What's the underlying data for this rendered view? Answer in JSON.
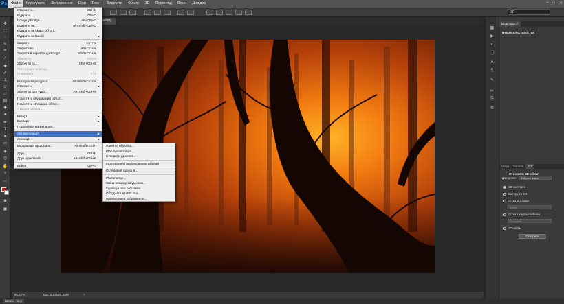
{
  "app": {
    "logo": "Ps"
  },
  "menubar": [
    "Файл",
    "Редагувати",
    "Зображення",
    "Шар",
    "Текст",
    "Виділити",
    "Фільтр",
    "3D",
    "Перегляд",
    "Вікно",
    "Довідка"
  ],
  "options": {
    "workspace": "3D"
  },
  "tabs": [
    {
      "label": "…ерфейс.png @ 50% (RGB/8#)",
      "active": false
    },
    {
      "label": "66.jpg @ 66,7% (RGB/8#)",
      "active": true
    }
  ],
  "file_menu": [
    {
      "label": "Створити ...",
      "shortcut": "Ctrl+N",
      "state": "normal"
    },
    {
      "label": "Відкрити...",
      "shortcut": "Ctrl+O",
      "state": "normal"
    },
    {
      "label": "Пошук у Bridge...",
      "shortcut": "Alt+Ctrl+O",
      "state": "normal"
    },
    {
      "label": "Відкрити як...",
      "shortcut": "Alt+Shift+Ctrl+O",
      "state": "normal"
    },
    {
      "label": "Відкрити як смарт-об'єкт...",
      "shortcut": "",
      "state": "normal"
    },
    {
      "label": "Відкрити останній",
      "shortcut": "",
      "state": "normal",
      "submenu": true
    },
    {
      "sep": true
    },
    {
      "label": "Закрити",
      "shortcut": "Ctrl+W",
      "state": "normal"
    },
    {
      "label": "Закрити всі",
      "shortcut": "Alt+Ctrl+W",
      "state": "normal"
    },
    {
      "label": "Закрити й перейти до Bridge...",
      "shortcut": "Shift+Ctrl+W",
      "state": "normal"
    },
    {
      "label": "Зберегти",
      "shortcut": "Ctrl+S",
      "state": "disabled"
    },
    {
      "label": "Зберегти як...",
      "shortcut": "Shift+Ctrl+S",
      "state": "normal"
    },
    {
      "label": "Реєстрація на вході...",
      "shortcut": "",
      "state": "disabled"
    },
    {
      "label": "Повернути",
      "shortcut": "F12",
      "state": "disabled"
    },
    {
      "sep": true
    },
    {
      "label": "Виготувати ресурси...",
      "shortcut": "Alt+Shift+Ctrl+W",
      "state": "normal"
    },
    {
      "label": "Створити",
      "shortcut": "",
      "state": "normal",
      "submenu": true
    },
    {
      "label": "Зберегти для Web...",
      "shortcut": "Alt+Shift+Ctrl+S",
      "state": "normal"
    },
    {
      "sep": true
    },
    {
      "label": "Помістити вбудований об'єкт...",
      "shortcut": "",
      "state": "normal"
    },
    {
      "label": "Помістити зв'язаний об'єкт...",
      "shortcut": "",
      "state": "normal"
    },
    {
      "label": "Створити пакет...",
      "shortcut": "",
      "state": "disabled"
    },
    {
      "sep": true
    },
    {
      "label": "Імпорт",
      "shortcut": "",
      "state": "normal",
      "submenu": true
    },
    {
      "label": "Експорт",
      "shortcut": "",
      "state": "normal",
      "submenu": true
    },
    {
      "label": "Поділитися на Behance...",
      "shortcut": "",
      "state": "normal"
    },
    {
      "sep": true
    },
    {
      "label": "Автоматизація",
      "shortcut": "",
      "state": "highlighted",
      "submenu": true
    },
    {
      "label": "Сценарії",
      "shortcut": "",
      "state": "normal",
      "submenu": true
    },
    {
      "sep": true
    },
    {
      "label": "Інформація про файл...",
      "shortcut": "Alt+Shift+Ctrl+I",
      "state": "normal"
    },
    {
      "sep": true
    },
    {
      "label": "Друк...",
      "shortcut": "Ctrl+P",
      "state": "normal"
    },
    {
      "label": "Друк однієї копії",
      "shortcut": "Alt+Shift+Ctrl+P",
      "state": "normal"
    },
    {
      "sep": true
    },
    {
      "label": "Вийти",
      "shortcut": "Ctrl+Q",
      "state": "normal"
    }
  ],
  "automate_menu": [
    {
      "label": "Пакетна обробка..."
    },
    {
      "label": "PDF-презентація..."
    },
    {
      "label": "Створити дроплет..."
    },
    {
      "sep": true
    },
    {
      "label": "Кадрування і вирівнювання світлин"
    },
    {
      "sep": true
    },
    {
      "label": "Оглядовий аркуш II..."
    },
    {
      "sep": true
    },
    {
      "label": "Photomerge..."
    },
    {
      "label": "Зміна режиму за умовою..."
    },
    {
      "label": "Корекція лінз об'єктива..."
    },
    {
      "label": "Об'єднати в HDR Pro..."
    },
    {
      "label": "Припасувати зображення..."
    }
  ],
  "properties_panel": {
    "tab": "Властивості",
    "title": "Немає властивостей"
  },
  "panel_3d": {
    "tabs": [
      "Шари",
      "Канали",
      "3D"
    ],
    "title": "Створити 3D-об'єкт",
    "source_label": "Джерело:",
    "source_value": "Вибрані шари",
    "options": [
      {
        "label": "3D листівка",
        "selected": true
      },
      {
        "label": "Екструзія 3D",
        "selected": false
      },
      {
        "label": "Сітка зі стилю",
        "selected": false
      },
      {
        "label": "Сітка з карти глибини",
        "selected": false
      },
      {
        "label": "3D-об'єм",
        "selected": false
      }
    ],
    "select_1": "Конус",
    "select_2": "Площина",
    "create_button": "Створити"
  },
  "status": {
    "zoom": "66,67%",
    "doc": "Док: 6,59М/6,59М"
  },
  "timeline_tab": "Шкала часу",
  "colors": {
    "foreground": "#d21f1f",
    "background": "#ffffff",
    "highlight": "#3c6fc1"
  }
}
